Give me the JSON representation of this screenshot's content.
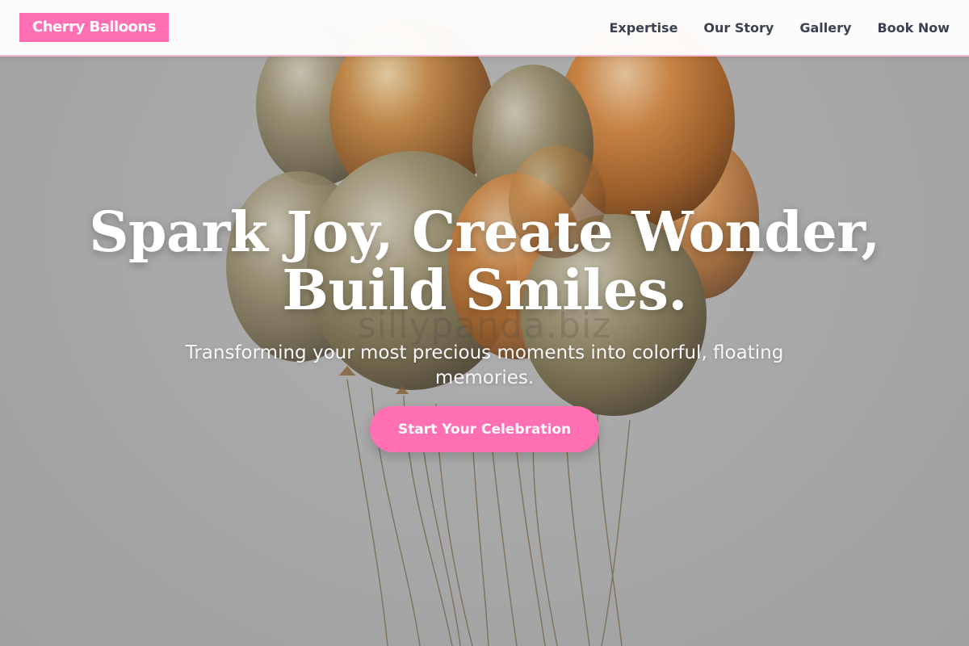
{
  "brand": {
    "name": "Cherry Balloons",
    "color": "#ff6fb3"
  },
  "nav": {
    "items": [
      {
        "label": "Expertise"
      },
      {
        "label": "Our Story"
      },
      {
        "label": "Gallery"
      },
      {
        "label": "Book Now"
      }
    ]
  },
  "hero": {
    "headline_line1": "Spark Joy, Create Wonder,",
    "headline_line2": "Build Smiles.",
    "subtitle": "Transforming your most precious moments into colorful, floating memories.",
    "cta_label": "Start Your Celebration",
    "watermark": "sillypanda.biz",
    "background_image": "golden-balloon-bouquet"
  },
  "colors": {
    "accent": "#ff6fb3",
    "nav_text": "#3b4151",
    "nav_border": "#f7b9cf",
    "headline": "#ffffff"
  }
}
